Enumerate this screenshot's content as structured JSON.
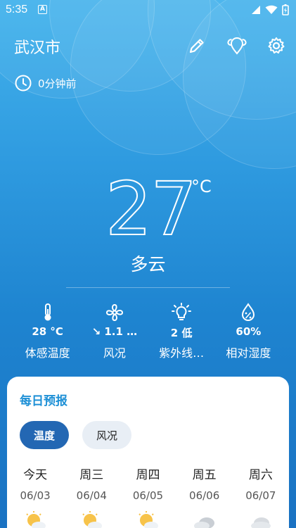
{
  "status_bar": {
    "time": "5:35",
    "notification_letter": "A"
  },
  "header": {
    "city": "武汉市",
    "updated": "0分钟前"
  },
  "current": {
    "temperature": "27",
    "unit": "°C",
    "condition": "多云"
  },
  "stats": [
    {
      "icon": "thermometer-icon",
      "value": "28 °C",
      "label": "体感温度"
    },
    {
      "icon": "fan-icon",
      "value": "↘ 1.1 …",
      "label": "风况"
    },
    {
      "icon": "uv-bulb-icon",
      "value": "2 低",
      "label": "紫外线…"
    },
    {
      "icon": "humidity-drop-icon",
      "value": "60%",
      "label": "相对湿度"
    }
  ],
  "daily": {
    "title": "每日预报",
    "tabs": [
      {
        "label": "温度",
        "active": true
      },
      {
        "label": "风况",
        "active": false
      }
    ],
    "days": [
      {
        "name": "今天",
        "date": "06/03",
        "icon": "partly-sunny-icon"
      },
      {
        "name": "周三",
        "date": "06/04",
        "icon": "partly-sunny-icon"
      },
      {
        "name": "周四",
        "date": "06/05",
        "icon": "partly-sunny-icon"
      },
      {
        "name": "周五",
        "date": "06/06",
        "icon": "cloudy-icon"
      },
      {
        "name": "周六",
        "date": "06/07",
        "icon": "cloudy-icon"
      }
    ]
  },
  "colors": {
    "accent": "#1e90d6",
    "chip_active": "#2367b3",
    "sky_top": "#44b3ec",
    "sky_bottom": "#1a72c2"
  }
}
